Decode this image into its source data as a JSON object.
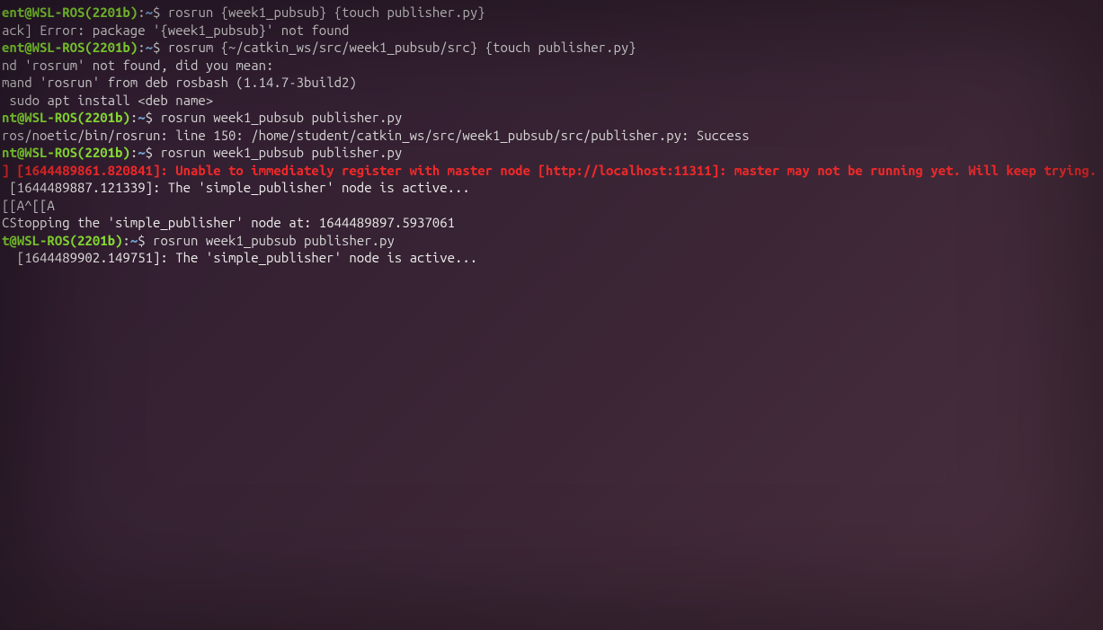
{
  "prompt": {
    "userPartial1": "nt",
    "userPartial2": "ent",
    "userPartial3": "t",
    "at": "@",
    "host": "WSL-ROS(2201b)",
    "colon": ":",
    "path": "~",
    "dollar": "$ "
  },
  "lines": {
    "cmd1": "rosrun {week1_pubsub} {touch publisher.py}",
    "err1": "ack] Error: package '{week1_pubsub}' not found",
    "cmd2": "rosrum {~/catkin_ws/src/week1_pubsub/src} {touch publisher.py}",
    "blank": "",
    "notfound": "nd 'rosrum' not found, did you mean:",
    "suggest": "mand 'rosrun' from deb rosbash (1.14.7-3build2)",
    "install": " sudo apt install <deb name>",
    "cmd3": "rosrun week1_pubsub publisher.py",
    "success": "ros/noetic/bin/rosrun: line 150: /home/student/catkin_ws/src/week1_pubsub/src/publisher.py: Success",
    "cmd4": "rosrun week1_pubsub publisher.py",
    "warnA": "] [1644489861.820841]:",
    "warnB": " Unable to immediately register with master node [http://localhost:11311]: master may not be running yet. Will keep trying.",
    "active1": " [1644489887.121339]: The 'simple_publisher' node is active...",
    "ctrl": "[[A^[[A",
    "stopping": "CStopping the 'simple_publisher' node at: 1644489897.5937061",
    "cmd5": "rosrun week1_pubsub publisher.py",
    "active2": "  [1644489902.149751]: The 'simple_publisher' node is active..."
  }
}
